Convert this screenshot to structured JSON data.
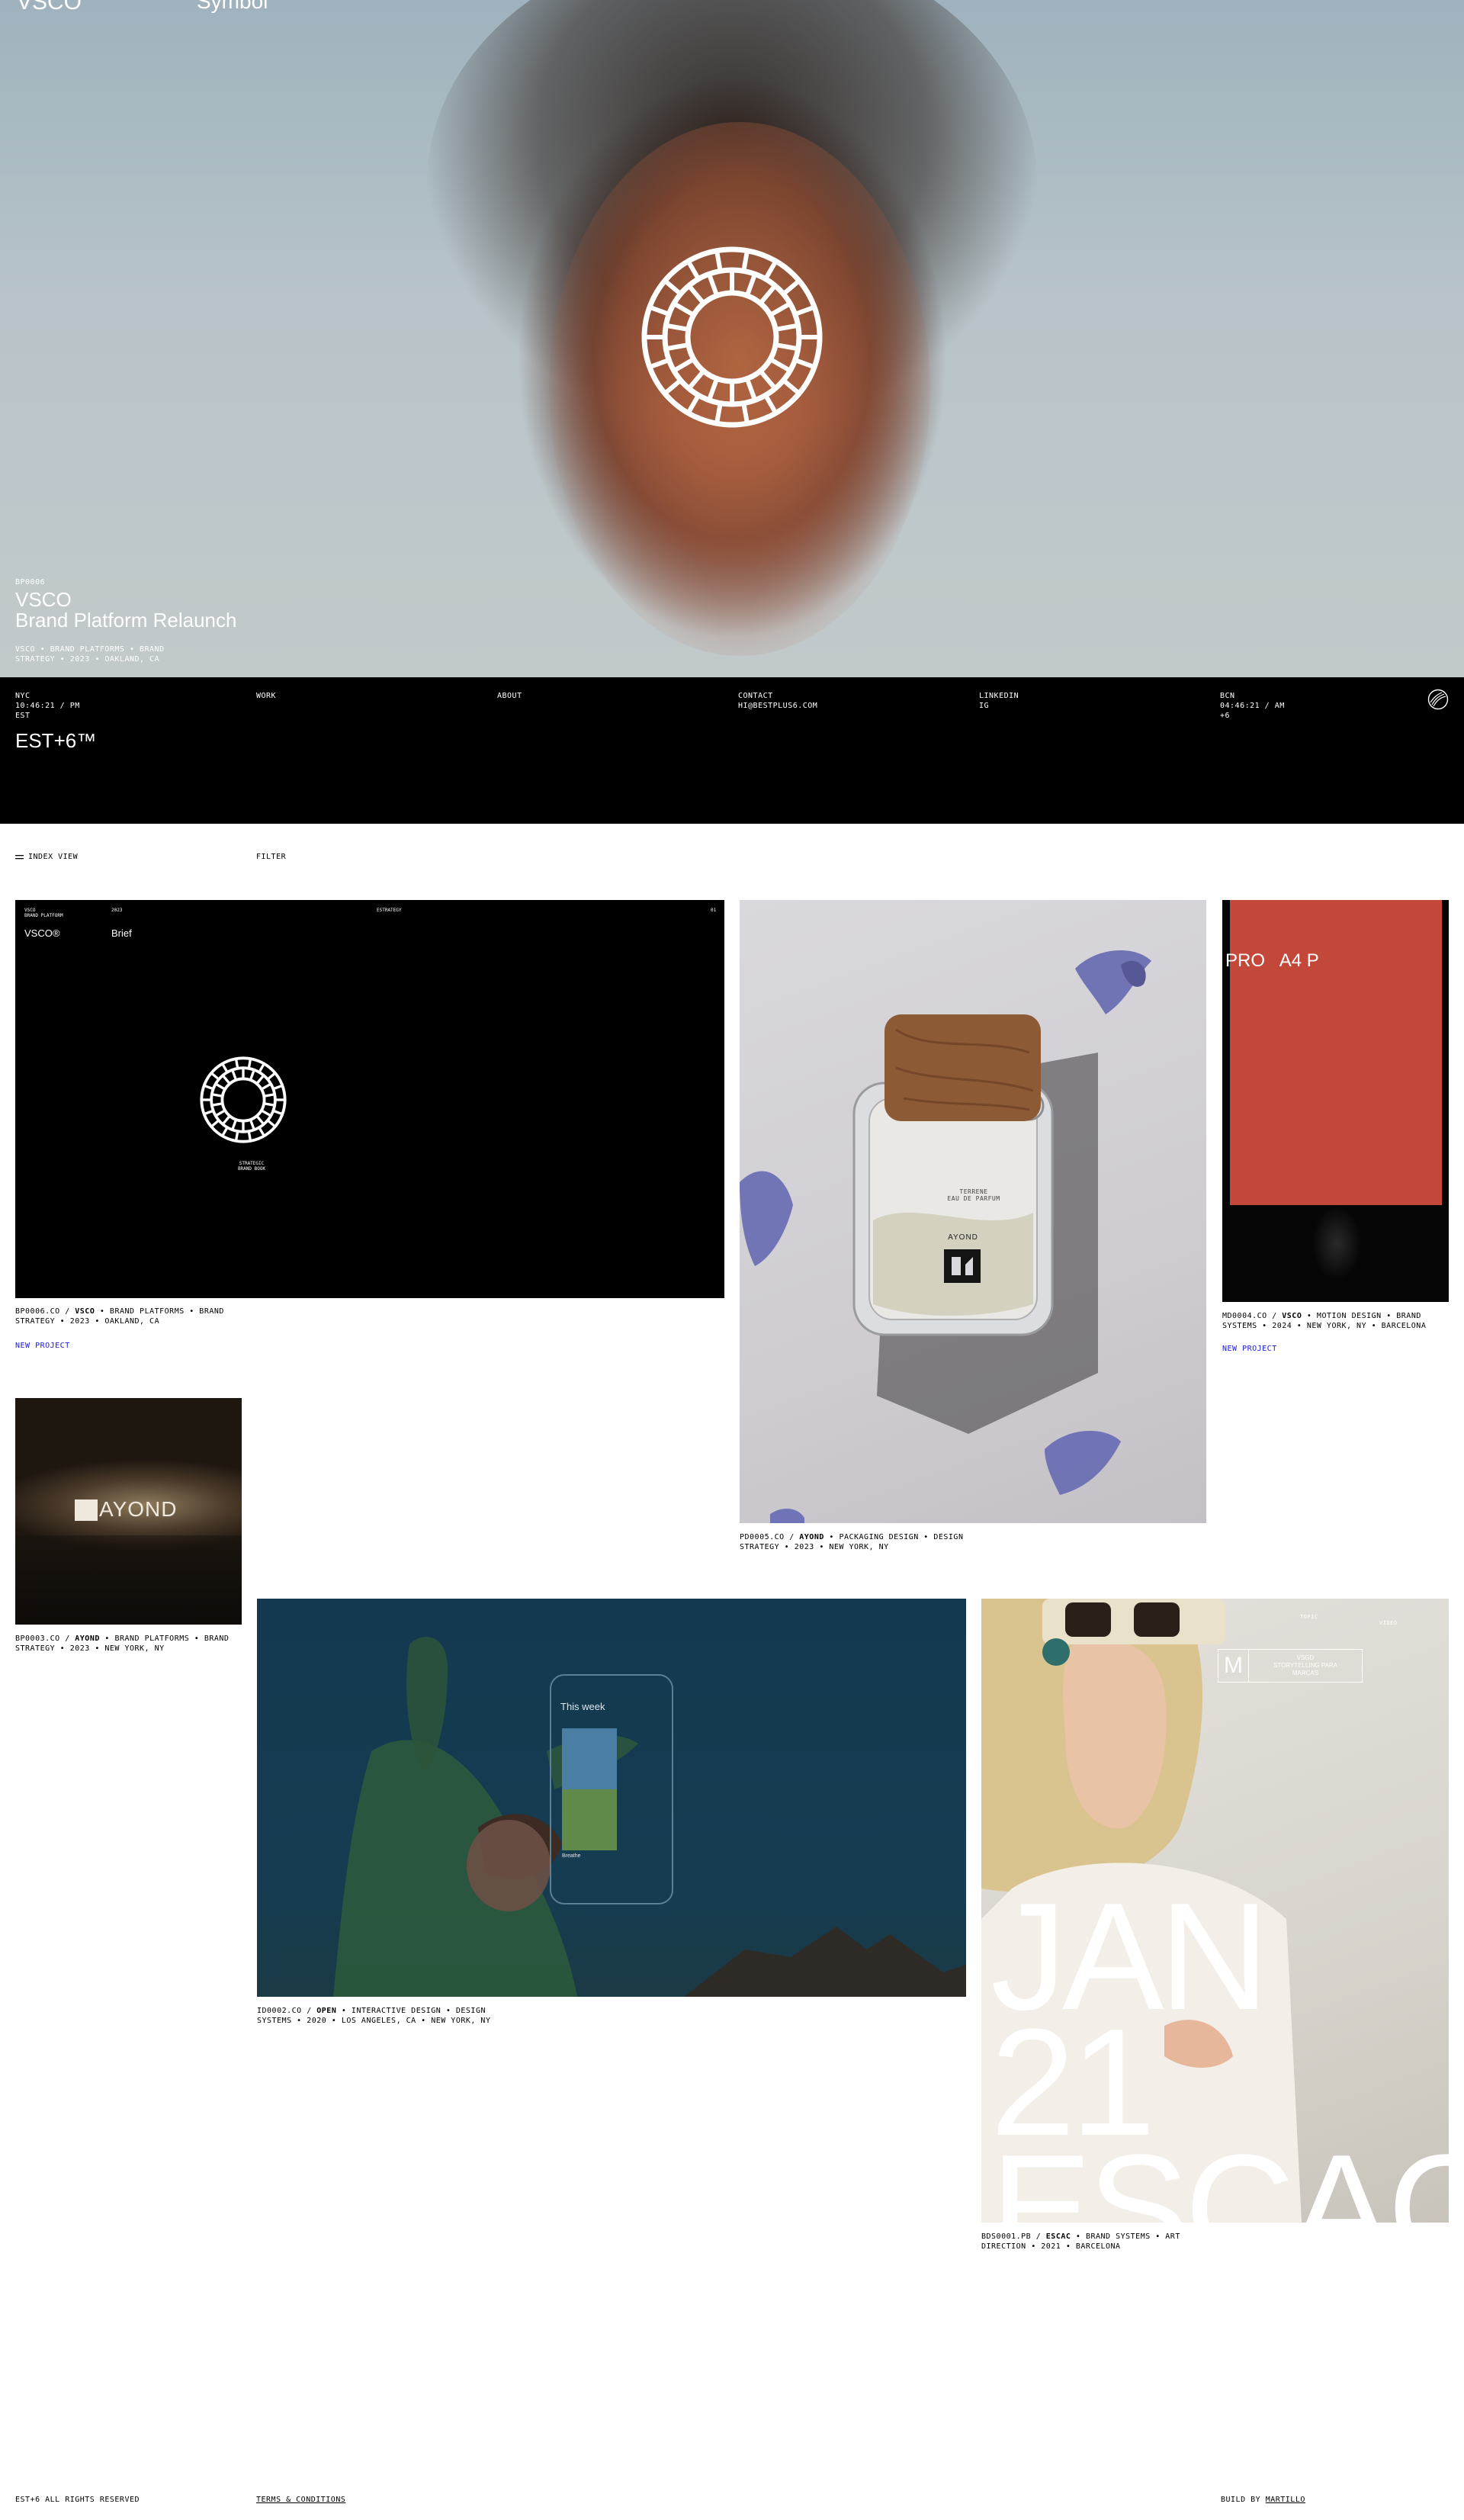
{
  "hero": {
    "brand": "VSCO",
    "brand_secondary": "Symbol",
    "code": "BP0006",
    "title_line1": "VSCO",
    "title_line2": "Brand Platform Relaunch",
    "tags_line1": "VSCO • BRAND PLATFORMS • BRAND",
    "tags_line2": "STRATEGY • 2023 • OAKLAND, CA",
    "logo_icon": "vsco-circle-icon"
  },
  "infobar": {
    "nyc": {
      "label": "NYC",
      "time": "10:46:21 / PM",
      "tz": "EST"
    },
    "work": "WORK",
    "about": "ABOUT",
    "contact": {
      "label": "CONTACT",
      "email": "HI@BESTPLUS6.COM"
    },
    "linkedin": {
      "label": "LINKEDIN",
      "ig": "IG"
    },
    "bcn": {
      "label": "BCN",
      "time": "04:46:21 / AM",
      "offset": "+6"
    },
    "tagline": "EST+6™",
    "globe_icon": "globe-icon"
  },
  "controls": {
    "index_view": "INDEX VIEW",
    "filter": "FILTER"
  },
  "cards": {
    "c1": {
      "img_brand": "VSCO®",
      "img_brief": "Brief",
      "img_top1": "VSCO",
      "img_top1b": "BRAND PLATFORM",
      "img_top2": "2023",
      "img_top3": "ESTRATEGY",
      "img_top4": "01",
      "img_center_caption1": "STRATEGIC",
      "img_center_caption2": "BRAND BOOK",
      "code": "BP0006.CO /",
      "client": "VSCO",
      "line1": "• BRAND PLATFORMS • BRAND",
      "line2": "STRATEGY • 2023 • OAKLAND, CA",
      "new_project": "NEW PROJECT"
    },
    "c2": {
      "bottle_text1": "TERRENE",
      "bottle_text2": "EAU DE PARFUM",
      "bottle_brand": "AYOND",
      "code": "PD0005.CO /",
      "client": "AYOND",
      "line1": "• PACKAGING DESIGN • DESIGN",
      "line2": "STRATEGY • 2023 • NEW YORK, NY"
    },
    "c3": {
      "poster_text": "PRO   A4 P",
      "code": "MD0004.CO /",
      "client": "VSCO",
      "line1": "• MOTION DESIGN • BRAND",
      "line2": "SYSTEMS • 2024 • NEW YORK, NY • BARCELONA",
      "new_project": "NEW PROJECT"
    },
    "c4": {
      "logo_text": "AYOND",
      "code": "BP0003.CO /",
      "client": "AYOND",
      "line1": "• BRAND PLATFORMS • BRAND",
      "line2": "STRATEGY • 2023 • NEW YORK, NY"
    },
    "c5": {
      "phone_title": "This week",
      "phone_caption": "Breathe",
      "code": "ID0002.CO /",
      "client": "OPEN",
      "line1": "• INTERACTIVE DESIGN • DESIGN",
      "line2": "SYSTEMS • 2020 • LOS ANGELES, CA • NEW YORK, NY"
    },
    "c6": {
      "big1": "JAN",
      "big2": "21",
      "big3": "ESCAC",
      "badge_m": "M",
      "badge_text1": "VSGD",
      "badge_text2": "STORYTELLING PARA",
      "badge_text3": "MARCAS",
      "top_note1": "TOPIC",
      "top_note2": "VIDEO",
      "code": "BDS0001.PB /",
      "client": "ESCAC",
      "line1": "• BRAND SYSTEMS • ART",
      "line2": "DIRECTION • 2021 • BARCELONA"
    }
  },
  "footer": {
    "rights": "EST+6 ALL RIGHTS RESERVED",
    "terms": "TERMS & CONDITIONS",
    "build_prefix": "BUILD BY",
    "build_link": "MARTILLO"
  }
}
